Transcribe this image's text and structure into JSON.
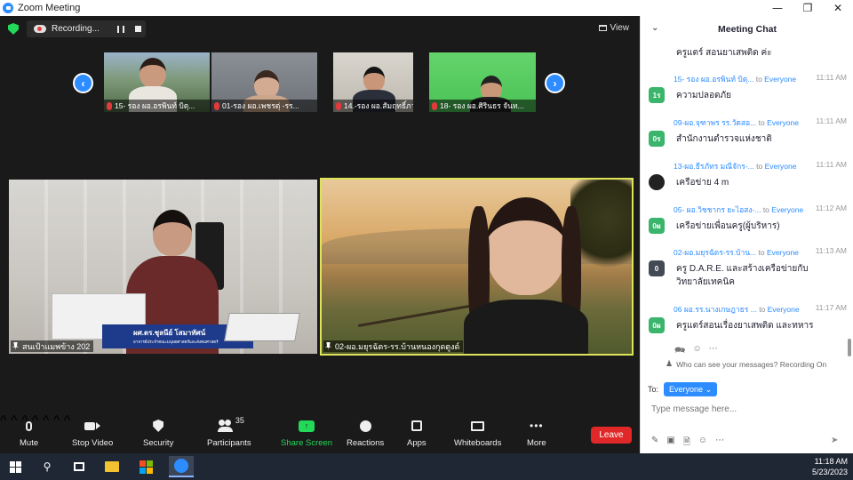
{
  "window": {
    "title": "Zoom Meeting"
  },
  "recording": {
    "label": "Recording..."
  },
  "view_label": "View",
  "thumbnails": [
    {
      "name": "15- รอง ผอ.อรพินท์ บิตุ..."
    },
    {
      "name": "01-รอง ผอ.เพชรตุ่ -รร..."
    },
    {
      "name": "14.-รอง ผอ.สัมฤทธิ์ภาพ ปร..."
    },
    {
      "name": "18- รอง ผอ.ศิรินธร จันท..."
    }
  ],
  "main_videos": [
    {
      "name": "สนเป้าแมพข้าง 202",
      "banner_name": "ผศ.ดร.ชุลนีย์ โสมาทัศน์",
      "banner_sub": "อาจารย์ประจำคณะมนุษยศาสตร์และสังคมศาสตร์"
    },
    {
      "name": "02-ผอ.มยุรฉัตร-รร.บ้านหนองกุดตูงด์"
    }
  ],
  "toolbar": {
    "mute": "Mute",
    "stop_video": "Stop Video",
    "security": "Security",
    "participants": "Participants",
    "participants_count": "35",
    "share_screen": "Share Screen",
    "reactions": "Reactions",
    "apps": "Apps",
    "whiteboards": "Whiteboards",
    "more": "More",
    "leave": "Leave"
  },
  "chat": {
    "title": "Meeting Chat",
    "top_fragment": "ครูแตร์ สอนยาเสพติด ค่ะ",
    "messages": [
      {
        "sender": "15- รอง ผอ.อรพินท์ บิตุ...",
        "to": "to",
        "recipient": "Everyone",
        "time": "11:11 AM",
        "avatar": "1ร",
        "avatar_color": "#3bb56b",
        "text": "ความปลอดภัย"
      },
      {
        "sender": "09-ผอ.จุฑาพร รร.วัดสอ...",
        "to": "to",
        "recipient": "Everyone",
        "time": "11:11 AM",
        "avatar": "0ร",
        "avatar_color": "#3bb56b",
        "text": "สำนักงานตำรวจแห่งชาติ"
      },
      {
        "sender": "13-ผอ.ธีรภัทร มณีจักร-...",
        "to": "to",
        "recipient": "Everyone",
        "time": "11:11 AM",
        "avatar": "",
        "avatar_color": "#222222",
        "text": "เครือข่าย 4 m"
      },
      {
        "sender": "05- ผอ.วิชชากร ยะไอสง-...",
        "to": "to",
        "recipient": "Everyone",
        "time": "11:12 AM",
        "avatar": "0ผ",
        "avatar_color": "#3bb56b",
        "text": "เครือข่ายเพื่อนครู(ผู้บริหาร)"
      },
      {
        "sender": "02-ผอ.มยุรฉัตร-รร.บ้าน...",
        "to": "to",
        "recipient": "Everyone",
        "time": "11:13 AM",
        "avatar": "0",
        "avatar_color": "#444a55",
        "text": "ครู D.A.R.E. และสร้างเครือข่ายกับ วิทยาลัยเทคนิค"
      },
      {
        "sender": "06 ผอ.รร.นางเกษฎาธร ...",
        "to": "to",
        "recipient": "Everyone",
        "time": "11:17 AM",
        "avatar": "0ผ",
        "avatar_color": "#3bb56b",
        "text": "ครูแตร์สอนเรื่องยาเสพติด และทหาร"
      }
    ],
    "visibility_note": "Who can see your messages? Recording On",
    "to_label": "To:",
    "to_value": "Everyone",
    "input_placeholder": "Type message here..."
  },
  "taskbar": {
    "time": "11:18 AM",
    "date": "5/23/2023"
  }
}
